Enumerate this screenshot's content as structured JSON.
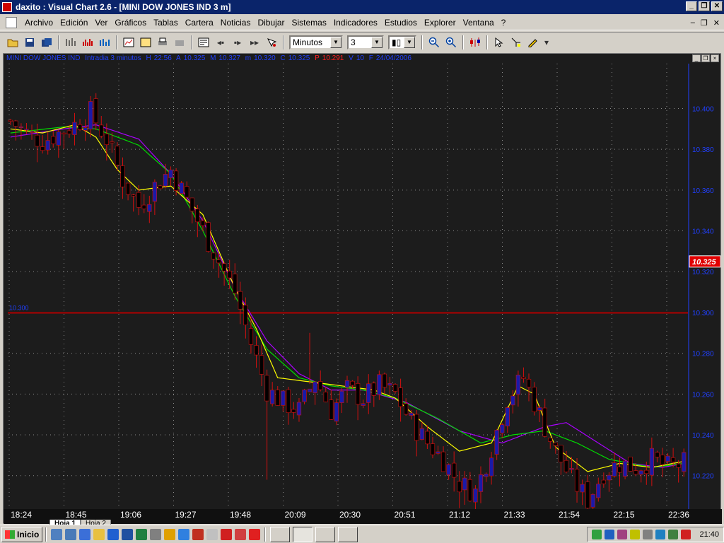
{
  "window": {
    "title": "daxito : Visual Chart  2.6 - [MINI DOW JONES IND 3 m]",
    "minimize": "_",
    "restore": "❐",
    "close": "✕"
  },
  "menu": {
    "items": [
      "Archivo",
      "Edición",
      "Ver",
      "Gráficos",
      "Tablas",
      "Cartera",
      "Noticias",
      "Dibujar",
      "Sistemas",
      "Indicadores",
      "Estudios",
      "Explorer",
      "Ventana",
      "?"
    ],
    "mdi_min": "–",
    "mdi_restore": "❐",
    "mdi_close": "✕"
  },
  "toolbar": {
    "interval_unit": "Minutos",
    "interval_value": "3",
    "chart_style": "▮▯"
  },
  "chart_header": {
    "name": "MINI DOW JONES IND",
    "mode": "Intradia 3 minutos",
    "h_label": "H",
    "h_time": "22:56",
    "a_label": "A",
    "a_value": "10.325",
    "m_label": "M",
    "m_value": "10.327",
    "min_label": "m",
    "min_value": "10.320",
    "c_label": "C",
    "c_value": "10.325",
    "p_label": "P",
    "p_value": "10.291",
    "v_label": "V",
    "v_value": "10",
    "d_label": "F",
    "date": "24/04/2006"
  },
  "chart_data": {
    "type": "candlestick",
    "ylim": [
      10.205,
      10.422
    ],
    "yticks": [
      "10.400",
      "10.380",
      "10.360",
      "10.340",
      "10.320",
      "10.300",
      "10.280",
      "10.260",
      "10.240",
      "10.220",
      "10.200"
    ],
    "xticks": [
      "18:24",
      "18:45",
      "19:06",
      "19:27",
      "19:48",
      "20:09",
      "20:30",
      "20:51",
      "21:12",
      "21:33",
      "21:54",
      "22:15",
      "22:36"
    ],
    "hline_label": "10.300",
    "hline_value": 10.3,
    "last_price": "10.325",
    "colors": {
      "bg": "#1c1c1c",
      "grid": "#8a8a8a",
      "up": "#1a1aa8",
      "down": "#000000",
      "wick": "#d01010",
      "ma_fast": "#ffff00",
      "ma_mid": "#00dd00",
      "ma_slow": "#aa00ff",
      "hline": "#b00000",
      "axis_text": "#2040ff",
      "last_bg": "#e00000"
    },
    "close_path": [
      [
        0,
        10.394
      ],
      [
        3,
        10.388
      ],
      [
        6,
        10.384
      ],
      [
        9,
        10.388
      ],
      [
        12,
        10.392
      ],
      [
        15,
        10.398
      ],
      [
        18,
        10.385
      ],
      [
        21,
        10.365
      ],
      [
        24,
        10.352
      ],
      [
        27,
        10.362
      ],
      [
        30,
        10.37
      ],
      [
        33,
        10.355
      ],
      [
        36,
        10.34
      ],
      [
        39,
        10.325
      ],
      [
        42,
        10.31
      ],
      [
        45,
        10.285
      ],
      [
        48,
        10.262
      ],
      [
        51,
        10.256
      ],
      [
        54,
        10.252
      ],
      [
        57,
        10.268
      ],
      [
        60,
        10.252
      ],
      [
        63,
        10.262
      ],
      [
        66,
        10.258
      ],
      [
        69,
        10.264
      ],
      [
        72,
        10.26
      ],
      [
        75,
        10.246
      ],
      [
        78,
        10.236
      ],
      [
        81,
        10.228
      ],
      [
        84,
        10.216
      ],
      [
        87,
        10.212
      ],
      [
        90,
        10.234
      ],
      [
        93,
        10.258
      ],
      [
        96,
        10.268
      ],
      [
        99,
        10.25
      ],
      [
        102,
        10.232
      ],
      [
        105,
        10.218
      ],
      [
        108,
        10.208
      ],
      [
        111,
        10.222
      ],
      [
        114,
        10.226
      ],
      [
        117,
        10.224
      ],
      [
        120,
        10.228
      ],
      [
        123,
        10.224
      ],
      [
        126,
        10.226
      ]
    ],
    "ma_fast_path": [
      [
        0,
        10.39
      ],
      [
        6,
        10.388
      ],
      [
        12,
        10.392
      ],
      [
        16,
        10.386
      ],
      [
        20,
        10.37
      ],
      [
        24,
        10.36
      ],
      [
        30,
        10.362
      ],
      [
        36,
        10.348
      ],
      [
        42,
        10.312
      ],
      [
        46,
        10.292
      ],
      [
        50,
        10.268
      ],
      [
        56,
        10.266
      ],
      [
        62,
        10.264
      ],
      [
        68,
        10.262
      ],
      [
        72,
        10.258
      ],
      [
        78,
        10.244
      ],
      [
        84,
        10.232
      ],
      [
        90,
        10.236
      ],
      [
        95,
        10.264
      ],
      [
        98,
        10.26
      ],
      [
        102,
        10.234
      ],
      [
        108,
        10.222
      ],
      [
        114,
        10.226
      ],
      [
        120,
        10.224
      ],
      [
        126,
        10.227
      ]
    ],
    "ma_mid_path": [
      [
        0,
        10.388
      ],
      [
        10,
        10.391
      ],
      [
        16,
        10.39
      ],
      [
        24,
        10.382
      ],
      [
        30,
        10.368
      ],
      [
        36,
        10.34
      ],
      [
        42,
        10.308
      ],
      [
        48,
        10.282
      ],
      [
        54,
        10.268
      ],
      [
        60,
        10.264
      ],
      [
        66,
        10.262
      ],
      [
        72,
        10.258
      ],
      [
        80,
        10.248
      ],
      [
        88,
        10.236
      ],
      [
        94,
        10.24
      ],
      [
        100,
        10.242
      ],
      [
        106,
        10.236
      ],
      [
        112,
        10.228
      ],
      [
        120,
        10.224
      ],
      [
        126,
        10.226
      ]
    ],
    "ma_slow_path": [
      [
        0,
        10.386
      ],
      [
        10,
        10.39
      ],
      [
        16,
        10.392
      ],
      [
        24,
        10.385
      ],
      [
        30,
        10.368
      ],
      [
        36,
        10.345
      ],
      [
        42,
        10.312
      ],
      [
        48,
        10.286
      ],
      [
        54,
        10.27
      ],
      [
        60,
        10.262
      ],
      [
        66,
        10.262
      ],
      [
        74,
        10.256
      ],
      [
        84,
        10.242
      ],
      [
        92,
        10.236
      ],
      [
        100,
        10.244
      ],
      [
        104,
        10.246
      ],
      [
        110,
        10.236
      ],
      [
        116,
        10.226
      ],
      [
        122,
        10.224
      ],
      [
        126,
        10.226
      ]
    ]
  },
  "sheets": {
    "tab1": "Hoja 1",
    "tab2": "Hoja 2"
  },
  "taskbar": {
    "start_label": "Inicio",
    "clock": "21:40"
  }
}
